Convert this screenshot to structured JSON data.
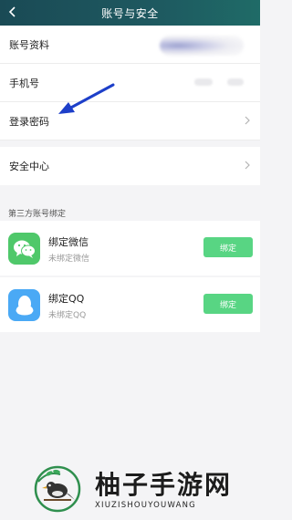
{
  "header": {
    "title": "账号与安全"
  },
  "rows": {
    "profile": {
      "label": "账号资料"
    },
    "phone": {
      "label": "手机号"
    },
    "password": {
      "label": "登录密码"
    },
    "security": {
      "label": "安全中心"
    }
  },
  "third_party": {
    "section_label": "第三方账号绑定",
    "wechat": {
      "title": "绑定微信",
      "status": "未绑定微信",
      "button": "绑定",
      "icon": "wechat-icon",
      "color": "#4fc86a"
    },
    "qq": {
      "title": "绑定QQ",
      "status": "未绑定QQ",
      "button": "绑定",
      "icon": "qq-icon",
      "color": "#4aa9f5"
    }
  },
  "watermark": {
    "name": "柚子手游网",
    "sub": "XIUZISHOUYOUWANG"
  },
  "colors": {
    "header": "#1e5960",
    "bind_button": "#58d583",
    "arrow": "#1d3fc9"
  }
}
